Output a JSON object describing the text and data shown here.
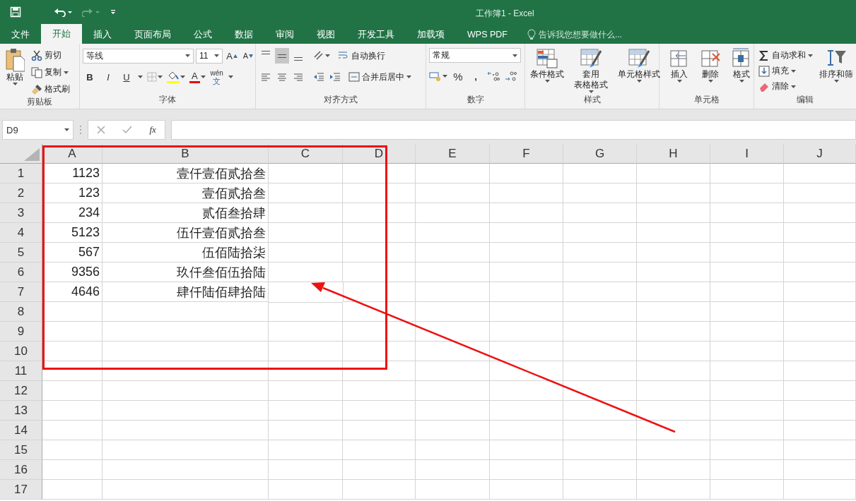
{
  "window": {
    "title": "工作簿1 - Excel"
  },
  "tabs": [
    {
      "label": "文件",
      "selected": false
    },
    {
      "label": "开始",
      "selected": true
    },
    {
      "label": "插入",
      "selected": false
    },
    {
      "label": "页面布局",
      "selected": false
    },
    {
      "label": "公式",
      "selected": false
    },
    {
      "label": "数据",
      "selected": false
    },
    {
      "label": "审阅",
      "selected": false
    },
    {
      "label": "视图",
      "selected": false
    },
    {
      "label": "开发工具",
      "selected": false
    },
    {
      "label": "加载项",
      "selected": false
    },
    {
      "label": "WPS PDF",
      "selected": false
    }
  ],
  "tell_me": {
    "placeholder": "告诉我您想要做什么..."
  },
  "ribbon": {
    "clipboard": {
      "label": "剪贴板",
      "paste": "粘贴",
      "actions": [
        "剪切",
        "复制",
        "格式刷"
      ]
    },
    "font": {
      "label": "字体",
      "font_name": "等线",
      "font_size": "11",
      "grow": "A",
      "shrink": "A",
      "styles": [
        "B",
        "I",
        "U"
      ],
      "font_color": "A",
      "phonetic": "wén",
      "phonetic_char": "文"
    },
    "alignment": {
      "label": "对齐方式",
      "vertical_align": [
        {
          "selected": false
        },
        {
          "selected": true
        },
        {
          "selected": false
        }
      ],
      "wrap": "自动换行",
      "merge": "合并后居中"
    },
    "number": {
      "label": "数字",
      "format": "常规",
      "percent": "%",
      "comma": ","
    },
    "styles": {
      "label": "样式",
      "buttons": [
        [
          "条件格式"
        ],
        [
          "套用",
          "表格格式"
        ],
        [
          "单元格样式"
        ]
      ]
    },
    "cells": {
      "label": "单元格",
      "buttons": [
        "插入",
        "删除",
        "格式"
      ]
    },
    "editing": {
      "label": "编辑",
      "autosum": "自动求和",
      "fill": "填充",
      "clear": "清除",
      "sort": "排序和筛"
    }
  },
  "formula_bar": {
    "name_box": "D9",
    "function_label": "fx"
  },
  "sheet": {
    "columns": [
      "A",
      "B",
      "C",
      "D",
      "E",
      "F",
      "G",
      "H",
      "I",
      "J"
    ],
    "rows": [
      {
        "number": "1",
        "cells": [
          "1123",
          "壹仟壹佰贰拾叁"
        ]
      },
      {
        "number": "2",
        "cells": [
          "123",
          "壹佰贰拾叁"
        ]
      },
      {
        "number": "3",
        "cells": [
          "234",
          "贰佰叁拾肆"
        ]
      },
      {
        "number": "4",
        "cells": [
          "5123",
          "伍仟壹佰贰拾叁"
        ]
      },
      {
        "number": "5",
        "cells": [
          "567",
          "伍佰陆拾柒"
        ]
      },
      {
        "number": "6",
        "cells": [
          "9356",
          "玖仟叁佰伍拾陆"
        ]
      },
      {
        "number": "7",
        "cells": [
          "4646",
          "肆仟陆佰肆拾陆"
        ]
      },
      {
        "number": "8",
        "cells": []
      },
      {
        "number": "9",
        "cells": []
      },
      {
        "number": "10",
        "cells": []
      },
      {
        "number": "11",
        "cells": []
      },
      {
        "number": "12",
        "cells": []
      },
      {
        "number": "13",
        "cells": []
      },
      {
        "number": "14",
        "cells": []
      },
      {
        "number": "15",
        "cells": []
      },
      {
        "number": "16",
        "cells": []
      },
      {
        "number": "17",
        "cells": []
      }
    ]
  }
}
